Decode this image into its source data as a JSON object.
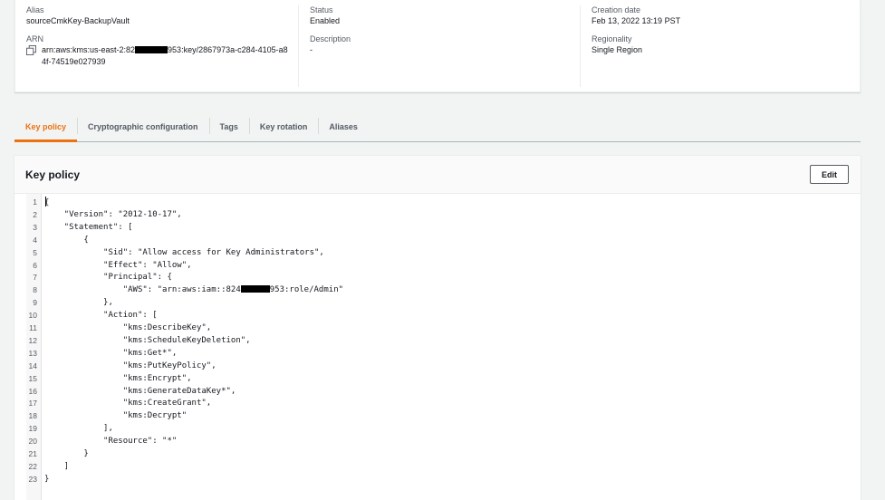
{
  "summary": {
    "alias_label": "Alias",
    "alias_value": "sourceCmkKey-BackupVault",
    "arn_label": "ARN",
    "arn_part1": "arn:aws:kms:us-east-2:82",
    "arn_part2": "953:key/2867973a-c284-4105-a8",
    "arn_line2": "4f-74519e027939",
    "status_label": "Status",
    "status_value": "Enabled",
    "description_label": "Description",
    "description_value": "-",
    "creation_label": "Creation date",
    "creation_value": "Feb 13, 2022 13:19 PST",
    "regionality_label": "Regionality",
    "regionality_value": "Single Region"
  },
  "tabs": [
    {
      "label": "Key policy",
      "active": true
    },
    {
      "label": "Cryptographic configuration",
      "active": false
    },
    {
      "label": "Tags",
      "active": false
    },
    {
      "label": "Key rotation",
      "active": false
    },
    {
      "label": "Aliases",
      "active": false
    }
  ],
  "panel": {
    "title": "Key policy",
    "edit_label": "Edit"
  },
  "policy_lines": [
    {
      "n": "1",
      "text": "{"
    },
    {
      "n": "2",
      "text": "    \"Version\": \"2012-10-17\","
    },
    {
      "n": "3",
      "text": "    \"Statement\": ["
    },
    {
      "n": "4",
      "text": "        {"
    },
    {
      "n": "5",
      "text": "            \"Sid\": \"Allow access for Key Administrators\","
    },
    {
      "n": "6",
      "text": "            \"Effect\": \"Allow\","
    },
    {
      "n": "7",
      "text": "            \"Principal\": {"
    },
    {
      "n": "8",
      "text": "                \"AWS\": \"arn:aws:iam::824",
      "redacted_tail": "953:role/Admin\""
    },
    {
      "n": "9",
      "text": "            },"
    },
    {
      "n": "10",
      "text": "            \"Action\": ["
    },
    {
      "n": "11",
      "text": "                \"kms:DescribeKey\","
    },
    {
      "n": "12",
      "text": "                \"kms:ScheduleKeyDeletion\","
    },
    {
      "n": "13",
      "text": "                \"kms:Get*\","
    },
    {
      "n": "14",
      "text": "                \"kms:PutKeyPolicy\","
    },
    {
      "n": "15",
      "text": "                \"kms:Encrypt\","
    },
    {
      "n": "16",
      "text": "                \"kms:GenerateDataKey*\","
    },
    {
      "n": "17",
      "text": "                \"kms:CreateGrant\","
    },
    {
      "n": "18",
      "text": "                \"kms:Decrypt\""
    },
    {
      "n": "19",
      "text": "            ],"
    },
    {
      "n": "20",
      "text": "            \"Resource\": \"*\""
    },
    {
      "n": "21",
      "text": "        }"
    },
    {
      "n": "22",
      "text": "    ]"
    },
    {
      "n": "23",
      "text": "}"
    }
  ],
  "colors": {
    "accent": "#ec7211",
    "redaction": "#000000"
  },
  "icons": {
    "copy": "copy-icon"
  }
}
